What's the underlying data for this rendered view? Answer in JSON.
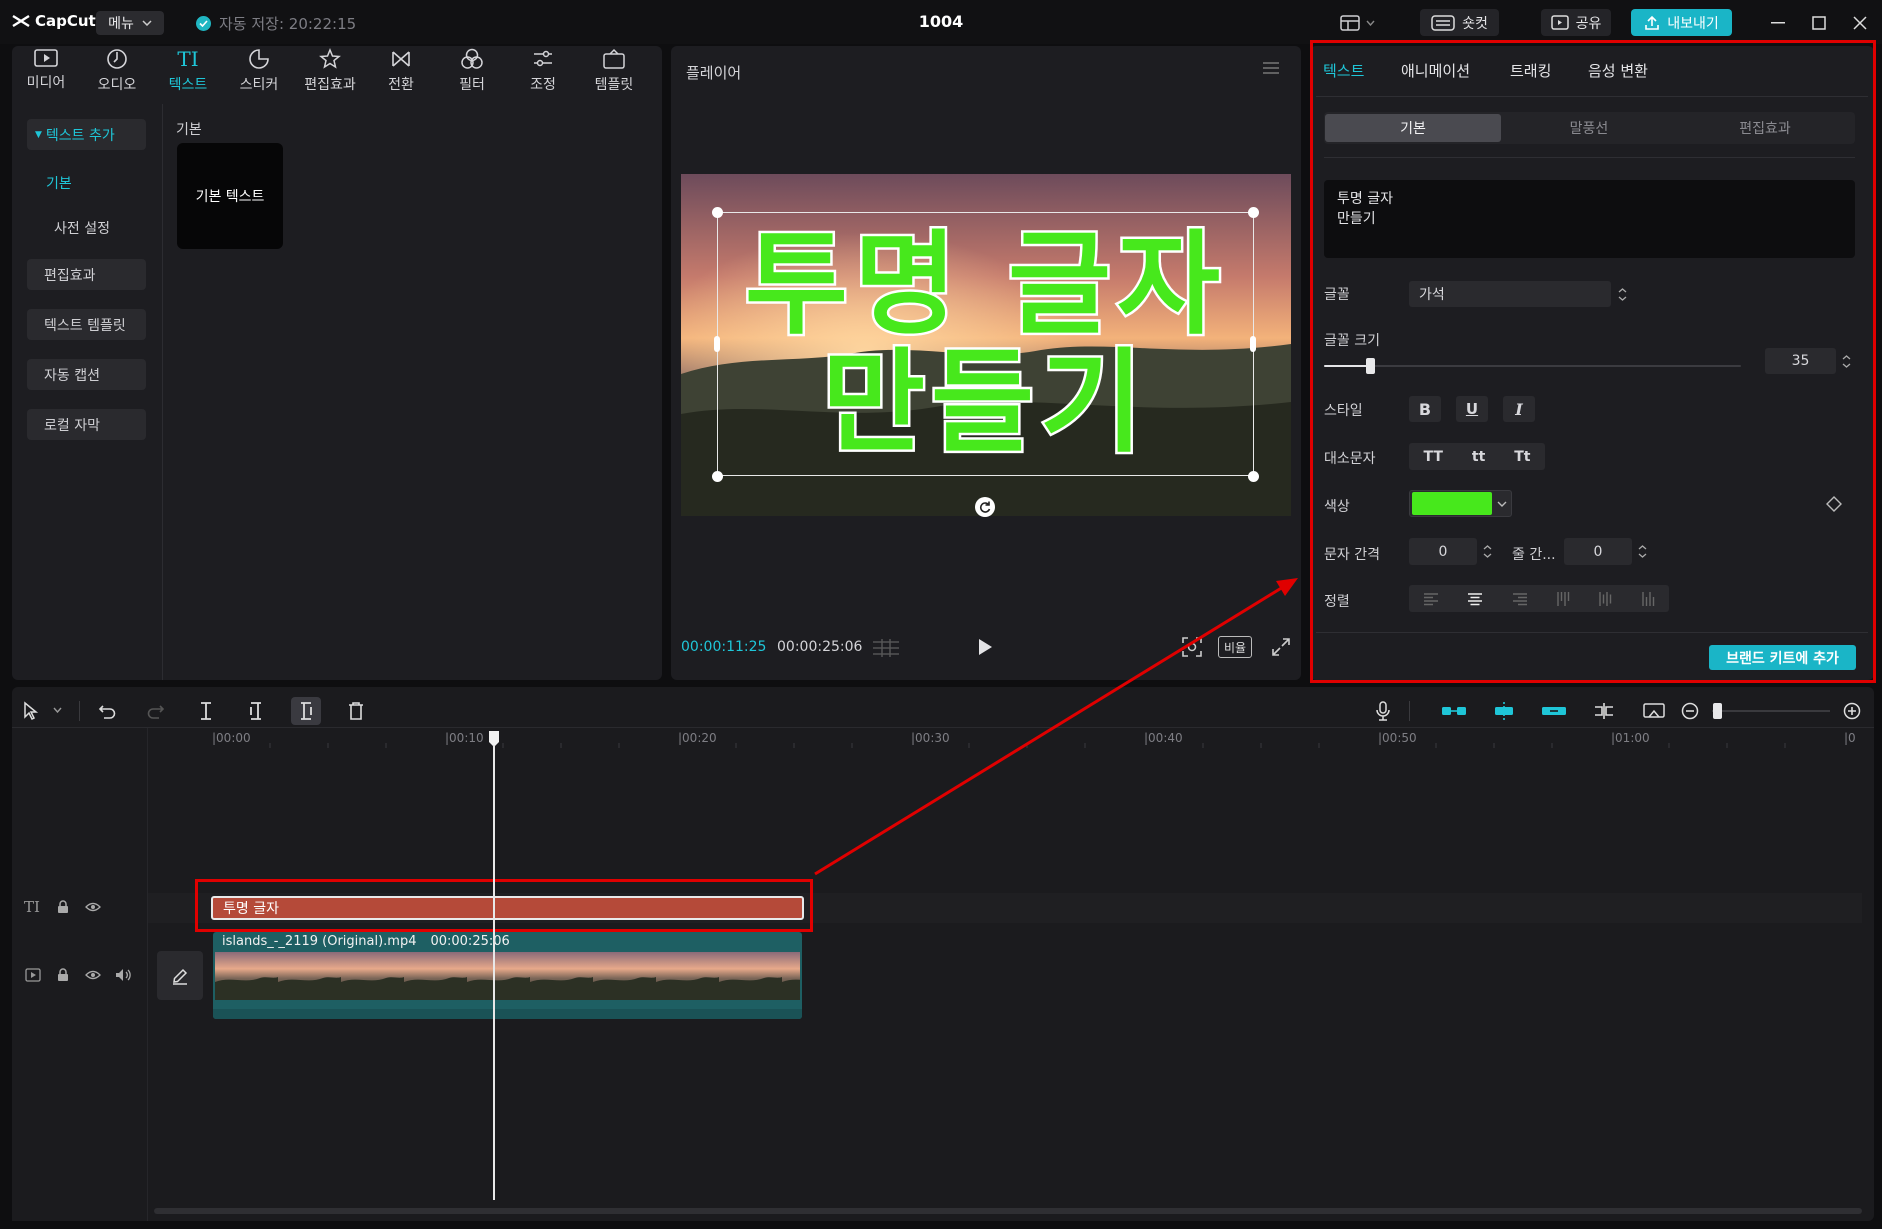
{
  "app": {
    "name": "CapCut",
    "menu_label": "메뉴",
    "autosave": "자동 저장: 20:22:15",
    "project_title": "1004",
    "shortcut_label": "숏컷",
    "share_label": "공유",
    "export_label": "내보내기"
  },
  "toolbar": {
    "tabs": [
      {
        "label": "미디어",
        "icon": "media-icon"
      },
      {
        "label": "오디오",
        "icon": "audio-icon"
      },
      {
        "label": "텍스트",
        "icon": "text-icon",
        "glyph": "TI"
      },
      {
        "label": "스티커",
        "icon": "sticker-icon"
      },
      {
        "label": "편집효과",
        "icon": "effects-icon"
      },
      {
        "label": "전환",
        "icon": "transition-icon"
      },
      {
        "label": "필터",
        "icon": "filter-icon"
      },
      {
        "label": "조정",
        "icon": "adjust-icon"
      },
      {
        "label": "템플릿",
        "icon": "template-icon"
      }
    ],
    "active_index": 2
  },
  "sidebar": {
    "group_label": "텍스트 추가",
    "items": [
      "기본",
      "사전 설정",
      "편집효과",
      "텍스트 템플릿",
      "자동 캡션",
      "로컬 자막"
    ]
  },
  "library": {
    "section_label": "기본",
    "cards": [
      {
        "label": "기본 텍스트"
      }
    ]
  },
  "player": {
    "title": "플레이어",
    "overlay_text_line1": "투명 글자",
    "overlay_text_line2": "만들기",
    "current_time": "00:00:11:25",
    "total_time": "00:00:25:06",
    "ratio_label": "비율"
  },
  "inspector": {
    "tabs": [
      "텍스트",
      "애니메이션",
      "트래킹",
      "음성 변환"
    ],
    "active_tab": 0,
    "subtabs": [
      "기본",
      "말풍선",
      "편집효과"
    ],
    "active_subtab": 0,
    "text_content_line1": "투명 글자",
    "text_content_line2": "만들기",
    "font_label": "글꼴",
    "font_value": "가석",
    "font_size_label": "글꼴 크기",
    "font_size_value": "35",
    "font_size_fraction": 0.11,
    "style_label": "스타일",
    "style_buttons": [
      "B",
      "U",
      "I"
    ],
    "case_label": "대소문자",
    "case_buttons": [
      "TT",
      "tt",
      "Tt"
    ],
    "color_label": "색상",
    "color_value": "#47e81c",
    "char_spacing_label": "문자 간격",
    "char_spacing_value": "0",
    "line_spacing_label": "줄 간...",
    "line_spacing_value": "0",
    "align_label": "정렬",
    "brand_kit_label": "브랜드 키트에 추가"
  },
  "timeline": {
    "ticks": [
      "|00:00",
      "|00:10",
      "|00:20",
      "|00:30",
      "|00:40",
      "|00:50",
      "|01:00",
      "|0"
    ],
    "text_clip_label": "투명 글자",
    "video_clip_label": "islands_-_2119 (Original).mp4",
    "video_clip_duration": "00:00:25:06"
  },
  "colors": {
    "accent": "#1fc6d8",
    "highlight": "#e00000",
    "text_clip": "#b54a39",
    "video_clip": "#1e5f63",
    "text_fill": "#47e81c"
  }
}
